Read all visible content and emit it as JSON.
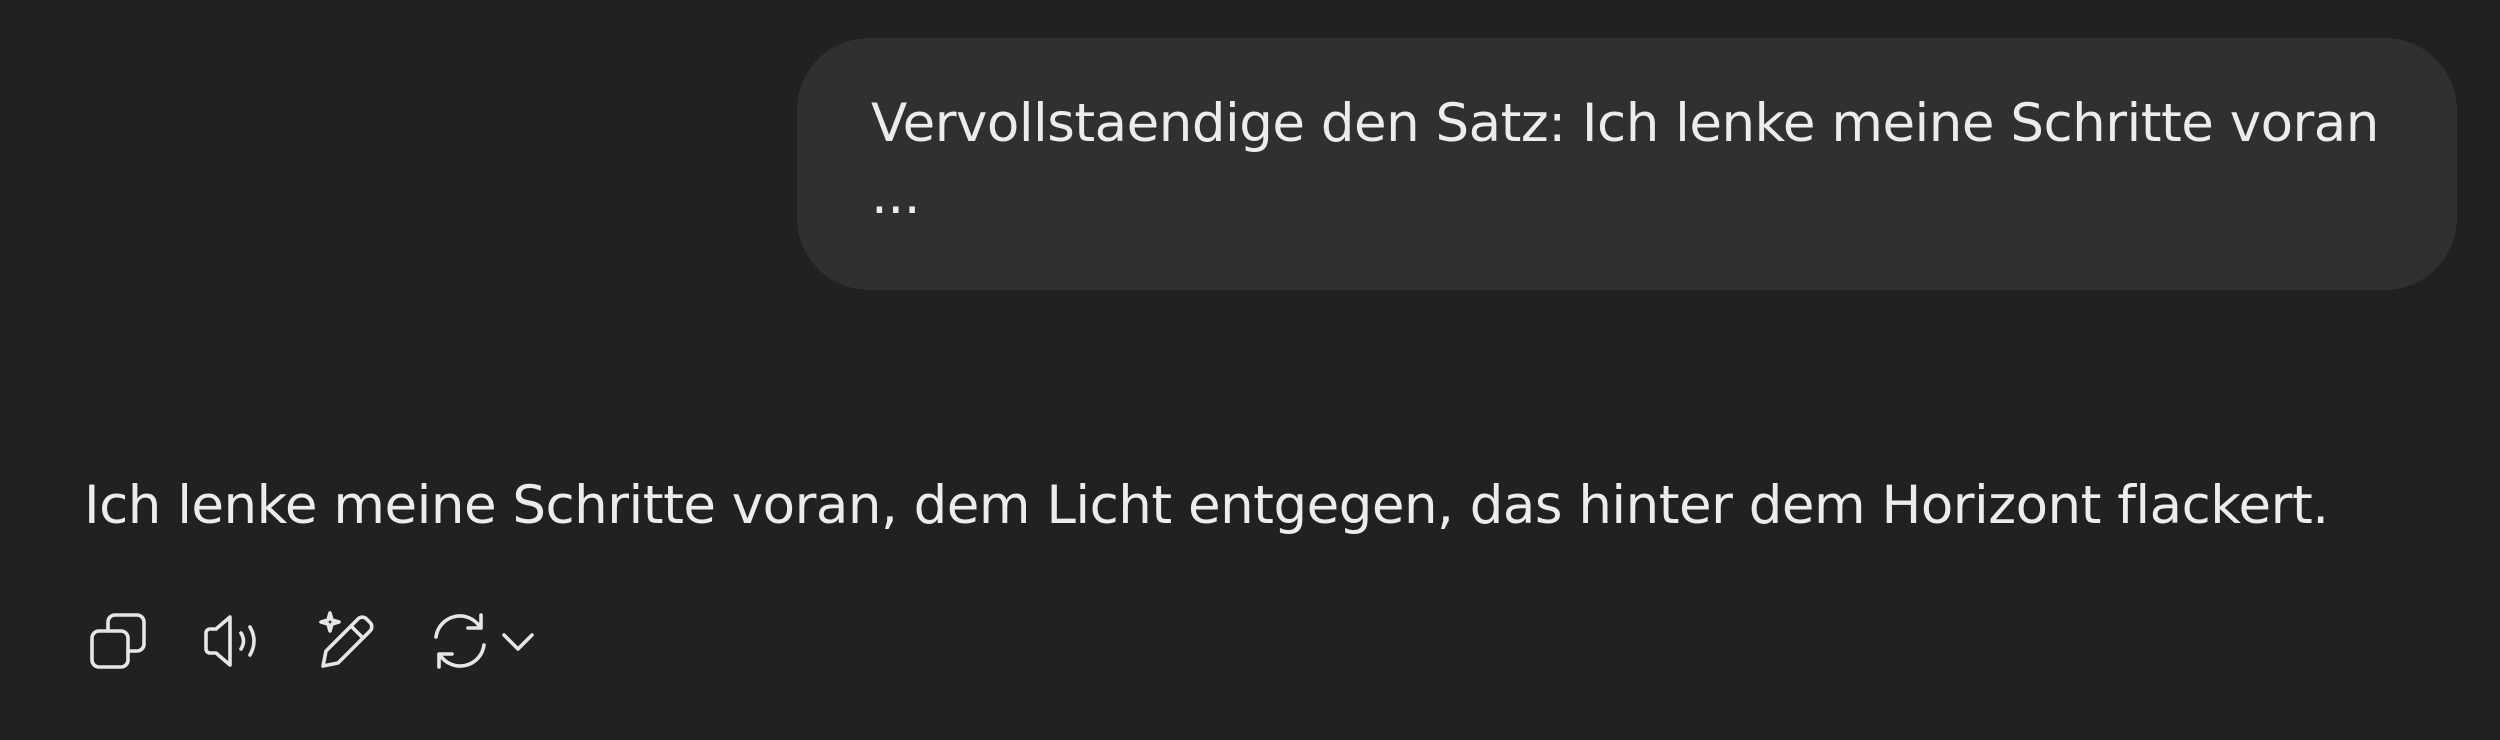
{
  "conversation": {
    "user_message": {
      "text": "Vervollstaendige den Satz: Ich lenke meine Schritte voran ..."
    },
    "assistant_message": {
      "text": "Ich lenke meine Schritte voran, dem Licht entgegen, das hinter dem Horizont flackert."
    }
  },
  "message_actions": {
    "icons": [
      "copy-icon",
      "read-aloud-icon",
      "edit-sparkle-icon",
      "regenerate-icon",
      "chevron-down-icon"
    ]
  },
  "colors": {
    "background": "#212121",
    "user_bubble": "#303030",
    "text": "#ececec",
    "icon": "#e6e6e6"
  }
}
